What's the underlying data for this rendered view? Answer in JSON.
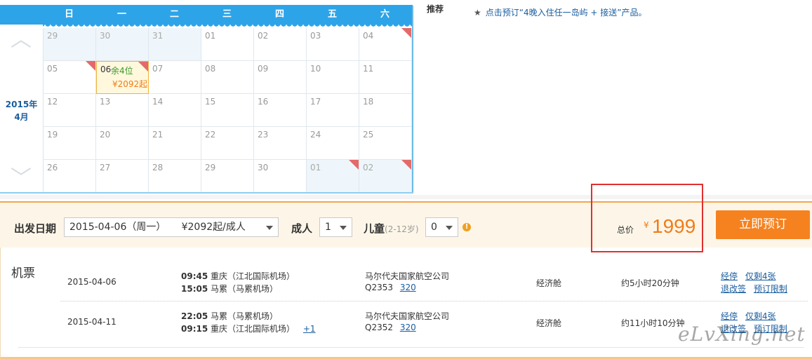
{
  "calendar": {
    "weekdays": [
      "日",
      "一",
      "二",
      "三",
      "四",
      "五",
      "六"
    ],
    "year_label": "2015年",
    "month_label": "4月",
    "rows": [
      [
        {
          "d": "29",
          "dim": true
        },
        {
          "d": "30",
          "dim": true
        },
        {
          "d": "31",
          "dim": true
        },
        {
          "d": "01"
        },
        {
          "d": "02"
        },
        {
          "d": "03"
        },
        {
          "d": "04",
          "flag": true
        }
      ],
      [
        {
          "d": "05",
          "flag": true
        },
        {
          "d": "06",
          "hl": true,
          "flag": true,
          "seats": "余4位",
          "price": "¥2092起"
        },
        {
          "d": "07"
        },
        {
          "d": "08"
        },
        {
          "d": "09"
        },
        {
          "d": "10"
        },
        {
          "d": "11"
        }
      ],
      [
        {
          "d": "12"
        },
        {
          "d": "13"
        },
        {
          "d": "14"
        },
        {
          "d": "15"
        },
        {
          "d": "16"
        },
        {
          "d": "17"
        },
        {
          "d": "18"
        }
      ],
      [
        {
          "d": "19"
        },
        {
          "d": "20"
        },
        {
          "d": "21"
        },
        {
          "d": "22"
        },
        {
          "d": "23"
        },
        {
          "d": "24"
        },
        {
          "d": "25"
        }
      ],
      [
        {
          "d": "26"
        },
        {
          "d": "27"
        },
        {
          "d": "28"
        },
        {
          "d": "29"
        },
        {
          "d": "30"
        },
        {
          "d": "01",
          "dim": true,
          "flag": true
        },
        {
          "d": "02",
          "dim": true,
          "flag": true
        }
      ]
    ]
  },
  "recommend": {
    "label": "推荐",
    "text": "点击预订“4晚入住任一岛屿 + 接送”产品。"
  },
  "booking": {
    "date_label": "出发日期",
    "date_value": "2015-04-06（周一）     ¥2092起/成人",
    "adult_label": "成人",
    "adult_value": "1",
    "child_label": "儿童",
    "child_age": "(2-12岁)",
    "child_value": "0",
    "total_label": "总价",
    "currency": "¥",
    "total_value": "1999",
    "book_button": "立即预订"
  },
  "flights": {
    "section_label": "机票",
    "items": [
      {
        "date": "2015-04-06",
        "dep_time": "09:45",
        "dep_place": "重庆（江北国际机场）",
        "arr_time": "15:05",
        "arr_place": "马累（马累机场）",
        "next_day": "",
        "airline": "马尔代夫国家航空公司",
        "flight_no": "Q2353",
        "plane": "320",
        "cabin": "经济舱",
        "duration": "约5小时20分钟",
        "stop": "经停",
        "remaining": "仅剩4张",
        "change": "退改签",
        "limit": "预订限制"
      },
      {
        "date": "2015-04-11",
        "dep_time": "22:05",
        "dep_place": "马累（马累机场）",
        "arr_time": "09:15",
        "arr_place": "重庆（江北国际机场）",
        "next_day": "+1",
        "airline": "马尔代夫国家航空公司",
        "flight_no": "Q2352",
        "plane": "320",
        "cabin": "经济舱",
        "duration": "约11小时10分钟",
        "stop": "经停",
        "remaining": "仅剩4张",
        "change": "退改签",
        "limit": "预订限制"
      }
    ]
  },
  "watermark": "eLvXing.net",
  "colors": {
    "calendar_header": "#2ea4e8",
    "accent_orange": "#f5821f",
    "price_orange": "#f07c1a",
    "highlight_red": "#e03030",
    "link_blue": "#1a5ea0"
  }
}
